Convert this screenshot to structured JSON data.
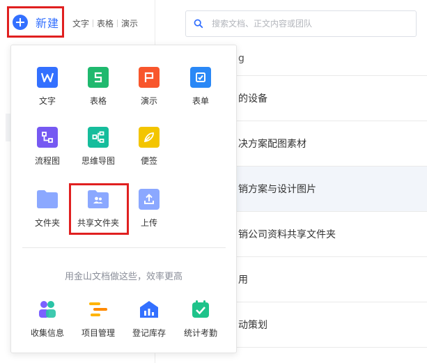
{
  "header": {
    "new_label": "新建",
    "quick_links": [
      "文字",
      "表格",
      "演示"
    ],
    "search_placeholder": "搜索文档、正文内容或团队"
  },
  "file_list": [
    "g",
    "的设备",
    "决方案配图素材",
    "销方案与设计图片",
    "销公司资料共享文件夹",
    "用",
    "动策划"
  ],
  "menu": {
    "docs": [
      {
        "label": "文字",
        "icon": "word-doc-icon",
        "color": "#3370ff"
      },
      {
        "label": "表格",
        "icon": "spreadsheet-icon",
        "color": "#1fb96e"
      },
      {
        "label": "演示",
        "icon": "presentation-icon",
        "color": "#f8562c"
      },
      {
        "label": "表单",
        "icon": "form-icon",
        "color": "#2a88f6"
      },
      {
        "label": "流程图",
        "icon": "flowchart-icon",
        "color": "#7659f2"
      },
      {
        "label": "思维导图",
        "icon": "mindmap-icon",
        "color": "#16bd9c"
      },
      {
        "label": "便签",
        "icon": "note-icon",
        "color": "#f3c500"
      },
      {
        "label": "文件夹",
        "icon": "folder-icon",
        "color": "#8ba8ff"
      },
      {
        "label": "共享文件夹",
        "icon": "shared-folder-icon",
        "color": "#8ba8ff"
      },
      {
        "label": "上传",
        "icon": "upload-icon",
        "color": "#8ba8ff"
      }
    ],
    "promo_text": "用金山文档做这些，效率更高",
    "apps": [
      {
        "label": "收集信息",
        "icon": "collect-info-icon"
      },
      {
        "label": "项目管理",
        "icon": "project-management-icon"
      },
      {
        "label": "登记库存",
        "icon": "inventory-icon"
      },
      {
        "label": "统计考勤",
        "icon": "attendance-icon"
      }
    ]
  }
}
